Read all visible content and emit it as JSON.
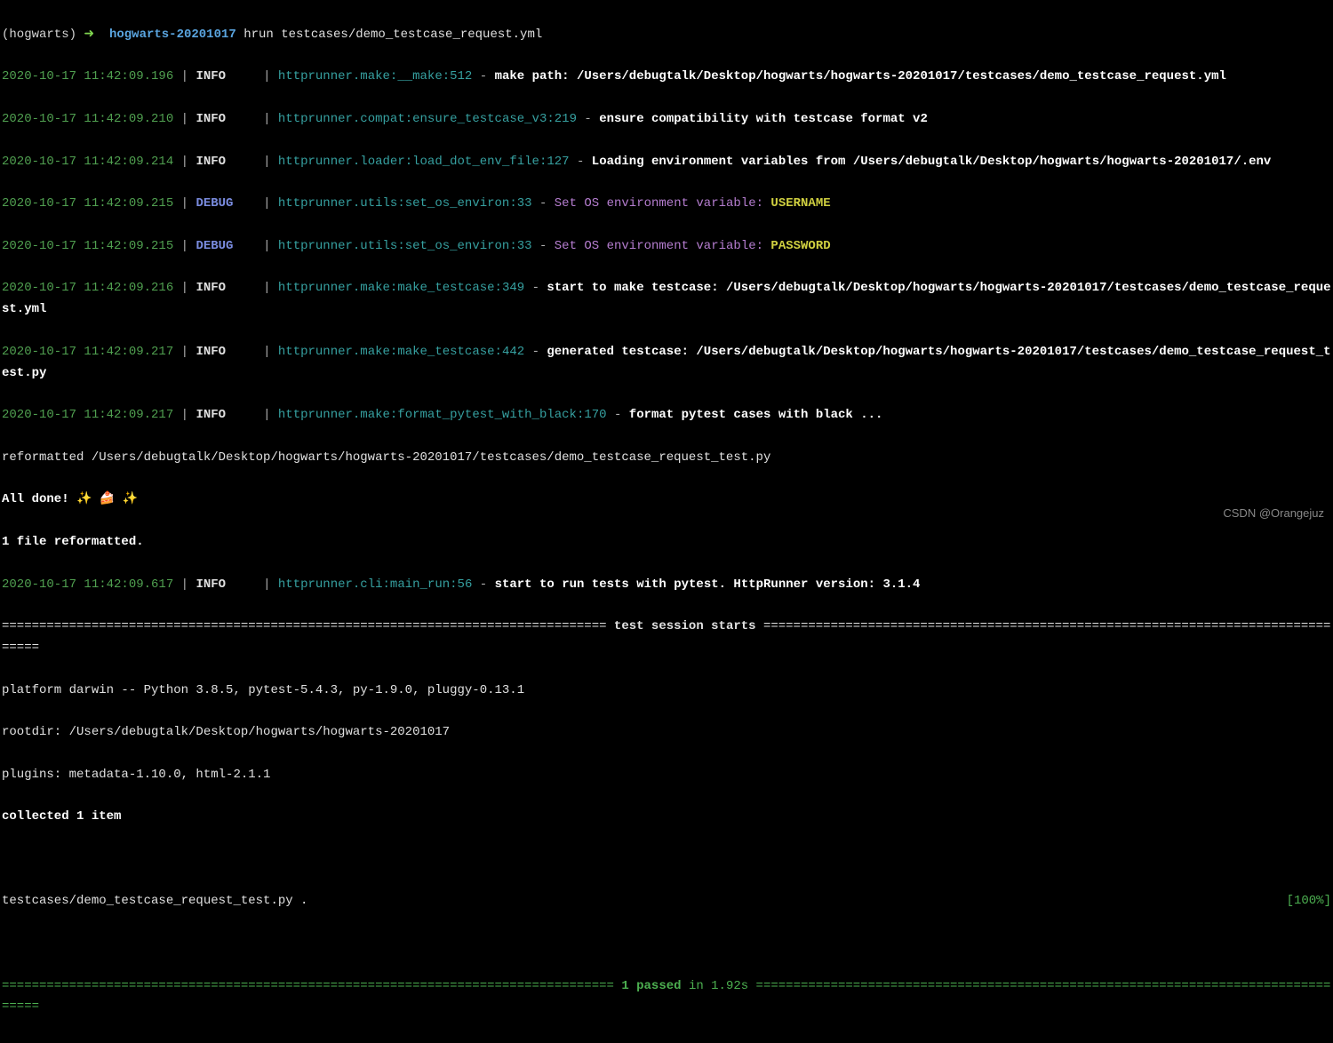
{
  "prompt": {
    "env": "(hogwarts)",
    "arrow": "➜",
    "dir": "hogwarts-20201017",
    "command": "hrun testcases/demo_testcase_request.yml"
  },
  "logs": [
    {
      "ts": "2020-10-17 11:42:09.196",
      "level": "INFO",
      "mod1": "httprunner.make:",
      "mod2": "__make:",
      "line": "512",
      "msg_bold": "make path: /Users/debugtalk/Desktop/hogwarts/hogwarts-20201017/testcases/demo_testcase_request.yml"
    },
    {
      "ts": "2020-10-17 11:42:09.210",
      "level": "INFO",
      "mod1": "httprunner.compat:",
      "mod2": "ensure_testcase_v3:",
      "line": "219",
      "msg_bold": "ensure compatibility with testcase format v2"
    },
    {
      "ts": "2020-10-17 11:42:09.214",
      "level": "INFO",
      "mod1": "httprunner.loader:",
      "mod2": "load_dot_env_file:",
      "line": "127",
      "msg_bold": "Loading environment variables from /Users/debugtalk/Desktop/hogwarts/hogwarts-20201017/.env"
    },
    {
      "ts": "2020-10-17 11:42:09.215",
      "level": "DEBUG",
      "mod1": "httprunner.utils:",
      "mod2": "set_os_environ:",
      "line": "33",
      "env_set": "Set OS environment variable: ",
      "env_var": "USERNAME"
    },
    {
      "ts": "2020-10-17 11:42:09.215",
      "level": "DEBUG",
      "mod1": "httprunner.utils:",
      "mod2": "set_os_environ:",
      "line": "33",
      "env_set": "Set OS environment variable: ",
      "env_var": "PASSWORD"
    },
    {
      "ts": "2020-10-17 11:42:09.216",
      "level": "INFO",
      "mod1": "httprunner.make:",
      "mod2": "make_testcase:",
      "line": "349",
      "msg_bold": "start to make testcase: /Users/debugtalk/Desktop/hogwarts/hogwarts-20201017/testcases/demo_testcase_request.yml"
    },
    {
      "ts": "2020-10-17 11:42:09.217",
      "level": "INFO",
      "mod1": "httprunner.make:",
      "mod2": "make_testcase:",
      "line": "442",
      "msg_bold": "generated testcase: /Users/debugtalk/Desktop/hogwarts/hogwarts-20201017/testcases/demo_testcase_request_test.py"
    },
    {
      "ts": "2020-10-17 11:42:09.217",
      "level": "INFO",
      "mod1": "httprunner.make:",
      "mod2": "format_pytest_with_black:",
      "line": "170",
      "msg_bold": "format pytest cases with black ..."
    }
  ],
  "reformat": {
    "reformatted": "reformatted /Users/debugtalk/Desktop/hogwarts/hogwarts-20201017/testcases/demo_testcase_request_test.py",
    "done": "All done!",
    "emojis": "✨ 🍰 ✨",
    "count": "1 file reformatted."
  },
  "run_log": {
    "ts": "2020-10-17 11:42:09.617",
    "level": "INFO",
    "mod1": "httprunner.cli:",
    "mod2": "main_run:",
    "line": "56",
    "msg_bold": "start to run tests with pytest. HttpRunner version: 3.1.4"
  },
  "pytest": {
    "sep_eq_left": "=================================================================================",
    "session_title": " test session starts ",
    "sep_eq_right": "=================================================================================",
    "platform": "platform darwin -- Python 3.8.5, pytest-5.4.3, py-1.9.0, pluggy-0.13.1",
    "rootdir": "rootdir: /Users/debugtalk/Desktop/hogwarts/hogwarts-20201017",
    "plugins": "plugins: metadata-1.10.0, html-2.1.1",
    "collected": "collected 1 item",
    "test_file": "testcases/demo_testcase_request_test.py .",
    "percent": "[100%]",
    "result_sep_left": "==================================================================================",
    "passed": " 1 passed ",
    "in_time": "in 1.92s",
    "result_sep_right": " =================================================================================="
  },
  "watermark": "CSDN @Orangejuz"
}
